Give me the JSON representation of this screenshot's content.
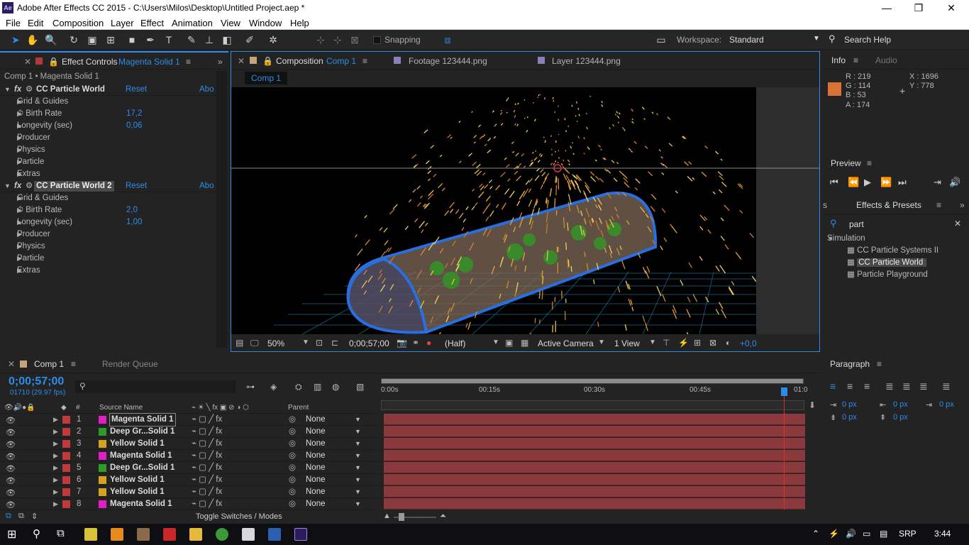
{
  "window": {
    "app_icon": "Ae",
    "title": "Adobe After Effects CC 2015 - C:\\Users\\Milos\\Desktop\\Untitled Project.aep *",
    "minimize": "—",
    "maximize": "❐",
    "close": "✕"
  },
  "menu": [
    "File",
    "Edit",
    "Composition",
    "Layer",
    "Effect",
    "Animation",
    "View",
    "Window",
    "Help"
  ],
  "toolbar": {
    "snapping": "Snapping",
    "workspace_label": "Workspace:",
    "workspace_value": "Standard",
    "search_help": "Search Help"
  },
  "effect_controls": {
    "tab_title": "Effect Controls",
    "tab_layer": "Magenta Solid 1",
    "breadcrumb": "Comp 1 • Magenta Solid 1",
    "effects": [
      {
        "name": "CC Particle World",
        "reset": "Reset",
        "about": "Abo",
        "props": [
          {
            "label": "Grid & Guides",
            "value": ""
          },
          {
            "label": "Birth Rate",
            "value": "17,2"
          },
          {
            "label": "Longevity (sec)",
            "value": "0,06"
          },
          {
            "label": "Producer",
            "value": ""
          },
          {
            "label": "Physics",
            "value": ""
          },
          {
            "label": "Particle",
            "value": ""
          },
          {
            "label": "Extras",
            "value": ""
          }
        ]
      },
      {
        "name": "CC Particle World 2",
        "reset": "Reset",
        "about": "Abo",
        "props": [
          {
            "label": "Grid & Guides",
            "value": ""
          },
          {
            "label": "Birth Rate",
            "value": "2,0"
          },
          {
            "label": "Longevity (sec)",
            "value": "1,00"
          },
          {
            "label": "Producer",
            "value": ""
          },
          {
            "label": "Physics",
            "value": ""
          },
          {
            "label": "Particle",
            "value": ""
          },
          {
            "label": "Extras",
            "value": ""
          }
        ]
      }
    ]
  },
  "composition": {
    "tab_title": "Composition",
    "tab_name": "Comp 1",
    "footage_tab": "Footage 123444.png",
    "layer_tab": "Layer 123444.png",
    "comp_chip": "Comp 1",
    "footer": {
      "zoom": "50%",
      "timecode": "0;00;57;00",
      "resolution": "(Half)",
      "camera": "Active Camera",
      "views": "1 View",
      "exposure": "+0,0"
    }
  },
  "info": {
    "tab": "Info",
    "audio_tab": "Audio",
    "r": "R : 219",
    "g": "G : 114",
    "b": "B : 53",
    "a": "A : 174",
    "x": "X : 1696",
    "y": "Y : 778",
    "color": "#db7235"
  },
  "preview": {
    "title": "Preview"
  },
  "effects_presets": {
    "tab_left": "s",
    "title": "Effects & Presets",
    "search": "part",
    "category": "Simulation",
    "items": [
      "CC Particle Systems II",
      "CC Particle World",
      "Particle Playground"
    ]
  },
  "paragraph": {
    "title": "Paragraph",
    "values": [
      "0 px",
      "0 px",
      "0 px",
      "0 px",
      "0 px"
    ]
  },
  "timeline": {
    "tab": "Comp 1",
    "render_queue": "Render Queue",
    "timecode": "0;00;57;00",
    "frames": "01710 (29.97 fps)",
    "col_num": "#",
    "col_source": "Source Name",
    "col_parent": "Parent",
    "toggle": "Toggle Switches / Modes",
    "ruler": [
      "0:00s",
      "00:15s",
      "00:30s",
      "00:45s",
      "01:0"
    ],
    "layers": [
      {
        "num": "1",
        "name": "Magenta Solid 1",
        "color": "#e21fc3",
        "parent": "None"
      },
      {
        "num": "2",
        "name": "Deep Gr...Solid 1",
        "color": "#2d9b2a",
        "parent": "None"
      },
      {
        "num": "3",
        "name": "Yellow Solid 1",
        "color": "#d3a21e",
        "parent": "None"
      },
      {
        "num": "4",
        "name": "Magenta Solid 1",
        "color": "#e21fc3",
        "parent": "None"
      },
      {
        "num": "5",
        "name": "Deep Gr...Solid 1",
        "color": "#2d9b2a",
        "parent": "None"
      },
      {
        "num": "6",
        "name": "Yellow Solid 1",
        "color": "#d3a21e",
        "parent": "None"
      },
      {
        "num": "7",
        "name": "Yellow Solid 1",
        "color": "#d3a21e",
        "parent": "None"
      },
      {
        "num": "8",
        "name": "Magenta Solid 1",
        "color": "#e21fc3",
        "parent": "None"
      }
    ]
  },
  "taskbar": {
    "lang": "SRP",
    "time": "3:44"
  }
}
